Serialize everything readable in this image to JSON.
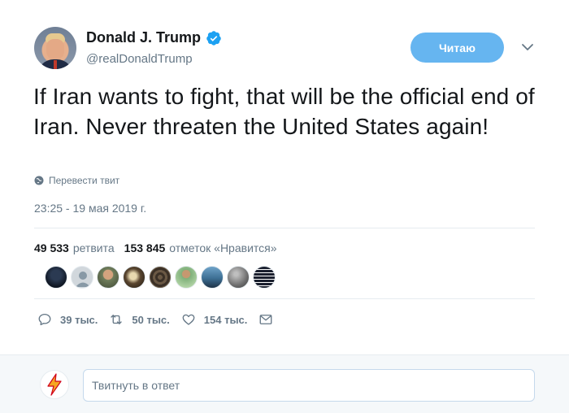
{
  "author": {
    "display_name": "Donald J. Trump",
    "handle": "@realDonaldTrump",
    "verified": true,
    "avatar_icon": "profile-photo"
  },
  "follow_button": {
    "label": "Читаю",
    "color": "#66b5f0"
  },
  "menu_icon": "chevron-down-icon",
  "tweet": {
    "text": "If Iran wants to fight, that will be the official end of Iran. Never threaten the United States again!",
    "translate_label": "Перевести твит",
    "timestamp": "23:25 - 19 мая 2019 г."
  },
  "stats": {
    "retweets_count": "49 533",
    "retweets_label": "ретвита",
    "likes_count": "153 845",
    "likes_label": "отметок «Нравится»"
  },
  "likers": [
    {
      "name": "liker-avatar-1",
      "color": "#1b2330"
    },
    {
      "name": "liker-avatar-2",
      "color": "#c7ccd1"
    },
    {
      "name": "liker-avatar-3",
      "color": "#7e8a6d"
    },
    {
      "name": "liker-avatar-4",
      "color": "#4a3e2c"
    },
    {
      "name": "liker-avatar-5",
      "color": "#5b4a3a"
    },
    {
      "name": "liker-avatar-6",
      "color": "#9fc49c"
    },
    {
      "name": "liker-avatar-7",
      "color": "#3d6f94"
    },
    {
      "name": "liker-avatar-8",
      "color": "#7f7f7f"
    },
    {
      "name": "liker-avatar-9",
      "color": "#1a1f2e"
    }
  ],
  "actions": {
    "replies": "39 тыс.",
    "retweets": "50 тыс.",
    "likes": "154 тыс."
  },
  "reply": {
    "placeholder": "Твитнуть в ответ"
  },
  "colors": {
    "accent": "#1da1f2",
    "text_primary": "#14171a",
    "text_secondary": "#657786",
    "divider": "#e6ecf0"
  }
}
